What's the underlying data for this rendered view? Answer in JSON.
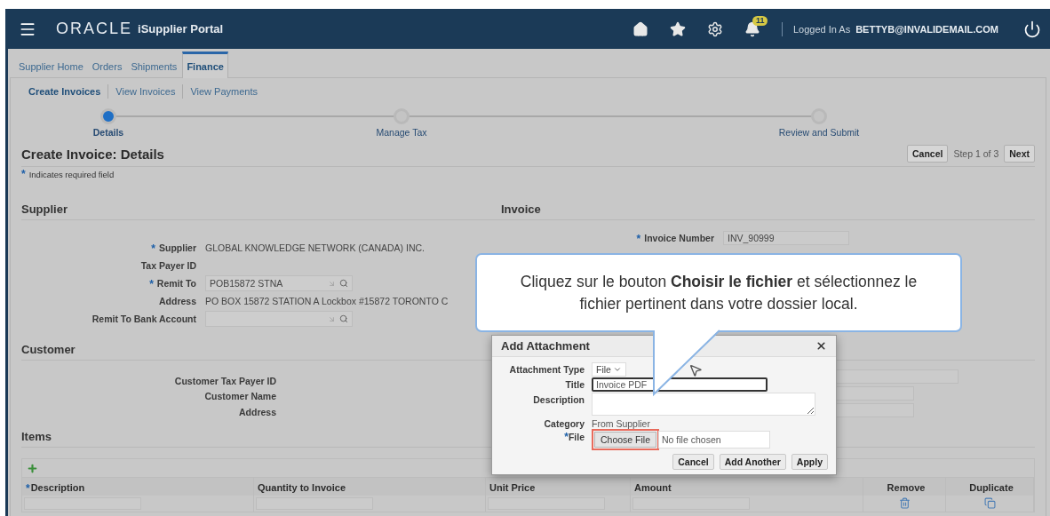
{
  "header": {
    "logo": "ORACLE",
    "app_name": "iSupplier Portal",
    "notification_count": "11",
    "logged_in_label": "Logged In As",
    "user": "BETTYB@INVALIDEMAIL.COM"
  },
  "tabs": [
    {
      "label": "Supplier Home",
      "selected": false
    },
    {
      "label": "Orders",
      "selected": false
    },
    {
      "label": "Shipments",
      "selected": false
    },
    {
      "label": "Finance",
      "selected": true
    }
  ],
  "subtabs": [
    {
      "label": "Create Invoices",
      "selected": true
    },
    {
      "label": "View Invoices",
      "selected": false
    },
    {
      "label": "View Payments",
      "selected": false
    }
  ],
  "train": [
    {
      "label": "Details",
      "selected": true
    },
    {
      "label": "Manage Tax",
      "selected": false
    },
    {
      "label": "Review and Submit",
      "selected": false
    }
  ],
  "page_title": "Create Invoice: Details",
  "page_actions": {
    "cancel": "Cancel",
    "step": "Step 1 of 3",
    "next": "Next"
  },
  "required_note": {
    "mark": "*",
    "text": "Indicates required field"
  },
  "supplier_section": {
    "title": "Supplier",
    "fields": [
      {
        "label": "Supplier",
        "mark": "*",
        "kind": "text",
        "value": "GLOBAL KNOWLEDGE NETWORK (CANADA) INC."
      },
      {
        "label": "Tax Payer ID",
        "kind": "text"
      },
      {
        "label": "Remit To",
        "mark": "*",
        "kind": "lov",
        "value": "POB15872 STNA"
      },
      {
        "label": "Address",
        "kind": "text",
        "value": "PO BOX 15872 STATION A Lockbox #15872 TORONTO C"
      },
      {
        "label": "Remit To Bank Account",
        "kind": "lov"
      }
    ]
  },
  "invoice_section": {
    "title": "Invoice",
    "fields": [
      {
        "label": "Invoice Number",
        "mark": "*",
        "value": "INV_90999"
      }
    ]
  },
  "customer_section": {
    "title": "Customer",
    "fields": [
      {
        "label": "Customer Tax Payer ID"
      },
      {
        "label": "Customer Name"
      },
      {
        "label": "Address"
      }
    ]
  },
  "items": {
    "title": "Items",
    "columns": [
      {
        "label": "Description",
        "mark": "*",
        "kind": "input"
      },
      {
        "label": "Quantity to Invoice",
        "kind": "input"
      },
      {
        "label": "Unit Price",
        "kind": "input"
      },
      {
        "label": "Amount",
        "kind": "input"
      },
      {
        "label": "Remove",
        "kind": "remove"
      },
      {
        "label": "Duplicate",
        "kind": "duplicate"
      }
    ]
  },
  "dialog": {
    "title": "Add Attachment",
    "fields": [
      {
        "label": "Attachment Type",
        "kind": "select",
        "value": "File"
      },
      {
        "label": "Title",
        "kind": "input",
        "value": "Invoice PDF"
      },
      {
        "label": "Description",
        "kind": "textarea"
      },
      {
        "label": "Category",
        "kind": "text",
        "value": "From Supplier"
      },
      {
        "label": "File",
        "mark": "*",
        "kind": "file",
        "button": "Choose File",
        "value": "No file chosen"
      }
    ],
    "buttons": [
      "Cancel",
      "Add Another",
      "Apply"
    ]
  },
  "callout": {
    "text": "Cliquez sur le bouton **Choisir le fichier** et sélectionnez le fichier pertinent dans votre dossier local."
  }
}
